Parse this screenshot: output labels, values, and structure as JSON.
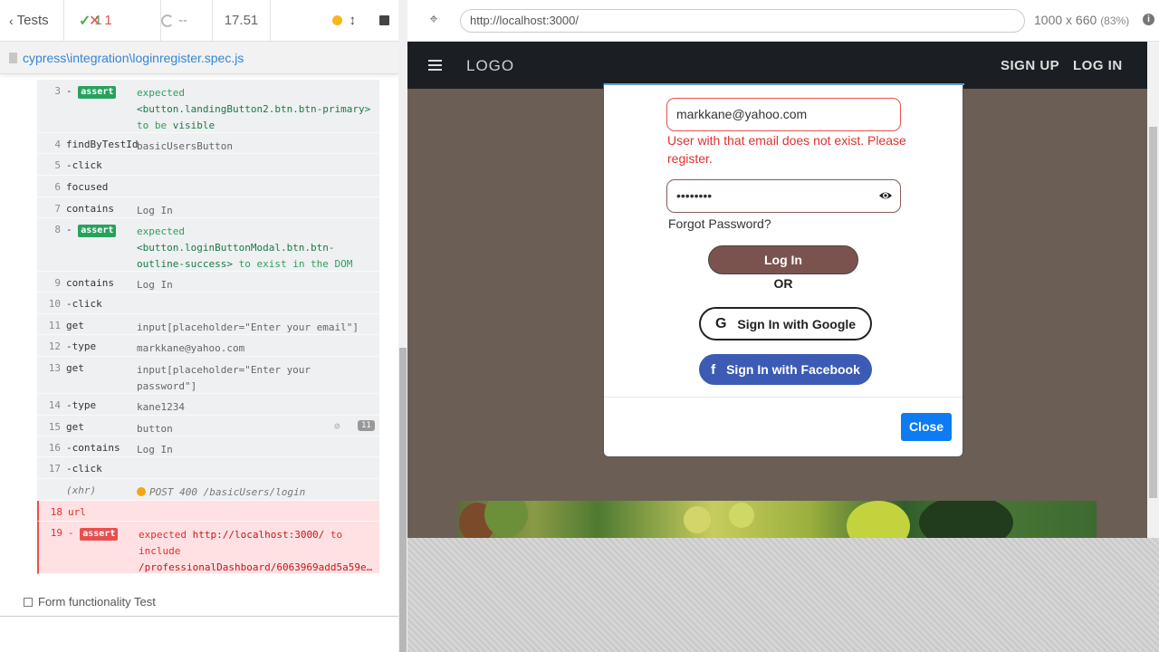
{
  "reporter": {
    "tests_label": "Tests",
    "passed": "1",
    "failed": "1",
    "pending": "--",
    "duration": "17.51",
    "spec_path": "cypress\\integration\\loginregister.spec.js",
    "commands": [
      {
        "n": "3",
        "name": "- assert",
        "badge": "assert",
        "msg": "expected <button.landingButton2.btn.btn-primary> to be visible"
      },
      {
        "n": "4",
        "name": "findByTestId",
        "msg": "basicUsersButton"
      },
      {
        "n": "5",
        "name": "-click",
        "msg": ""
      },
      {
        "n": "6",
        "name": "focused",
        "msg": ""
      },
      {
        "n": "7",
        "name": "contains",
        "msg": "Log In"
      },
      {
        "n": "8",
        "name": "- assert",
        "badge": "assert",
        "msg": "expected <button.loginButtonModal.btn.btn-outline-success> to exist in the DOM"
      },
      {
        "n": "9",
        "name": "contains",
        "msg": "Log In"
      },
      {
        "n": "10",
        "name": "-click",
        "msg": ""
      },
      {
        "n": "11",
        "name": "get",
        "msg": "input[placeholder=\"Enter your email\"]"
      },
      {
        "n": "12",
        "name": "-type",
        "msg": "markkane@yahoo.com"
      },
      {
        "n": "13",
        "name": "get",
        "msg": "input[placeholder=\"Enter your password\"]"
      },
      {
        "n": "14",
        "name": "-type",
        "msg": "kane1234"
      },
      {
        "n": "15",
        "name": "get",
        "msg": "button",
        "count": "11"
      },
      {
        "n": "16",
        "name": "-contains",
        "msg": "Log In"
      },
      {
        "n": "17",
        "name": "-click",
        "msg": ""
      },
      {
        "n": "",
        "name": "(xhr)",
        "msg": "POST 400 /basicUsers/login"
      },
      {
        "n": "18",
        "name": "url",
        "msg": ""
      },
      {
        "n": "19",
        "name": "- assert",
        "badge": "assert",
        "msg": "expected http://localhost:3000/ to include /professionalDashboard/6063969add5a59e…"
      }
    ],
    "assert_badge": "assert",
    "assert_texts": {
      "c3_a": "expected ",
      "c3_b": "<button.landingButton2.btn.btn-primary>",
      "c3_c": " to be ",
      "c3_d": "visible",
      "c8_a": "expected ",
      "c8_b": "<button.loginButtonModal.btn.btn-outline-success>",
      "c8_c": " to exist in the DOM",
      "c19_a": "expected ",
      "c19_b": "http://localhost:3000/",
      "c19_c": " to include ",
      "c19_d": "/professionalDashboard/6063969add5a59e…"
    },
    "next_test": "Form functionality Test"
  },
  "aut": {
    "url": "http://localhost:3000/",
    "viewport": "1000 x 660",
    "zoom": "(83%)",
    "navbar": {
      "logo": "LOGO",
      "signup": "SIGN UP",
      "login": "LOG IN"
    },
    "modal": {
      "email_value": "markkane@yahoo.com",
      "email_error": "User with that email does not exist. Please register.",
      "password_value": "••••••••",
      "forgot": "Forgot Password?",
      "login_button": "Log In",
      "or": "OR",
      "google_button": "Sign In with Google",
      "facebook_button": "Sign In with Facebook",
      "close_button": "Close"
    }
  },
  "colors": {
    "pass": "#4caf50",
    "fail": "#e94f4f",
    "link": "#3386d4",
    "login_btn": "#7b534e",
    "facebook": "#3b5bb5",
    "close_btn": "#0d7cf2"
  }
}
